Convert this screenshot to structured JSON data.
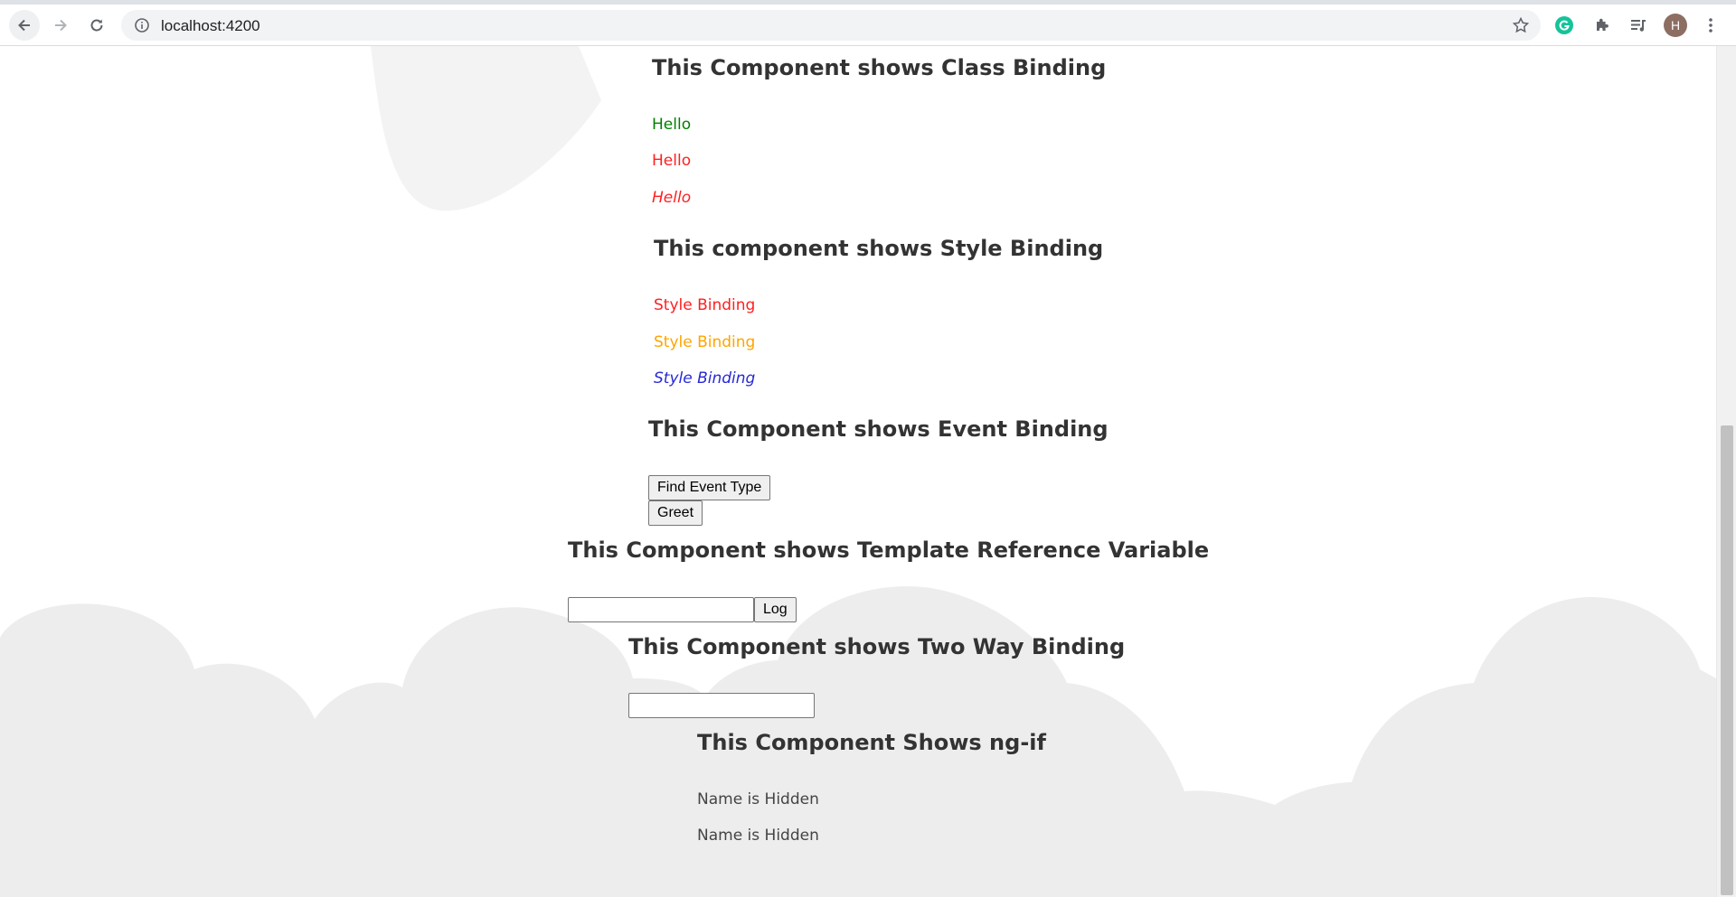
{
  "browser": {
    "url": "localhost:4200",
    "avatar_letter": "H",
    "icons": {
      "back": "arrow-left-icon",
      "forward": "arrow-right-icon",
      "reload": "reload-icon",
      "site_info": "info-icon",
      "bookmark": "star-icon",
      "grammarly": "grammarly-icon",
      "extensions": "puzzle-icon",
      "media": "media-queue-icon",
      "menu": "kebab-menu-icon"
    }
  },
  "class_binding": {
    "heading": "This Component shows Class Binding",
    "lines": [
      "Hello",
      "Hello",
      "Hello"
    ]
  },
  "style_binding": {
    "heading": "This component shows Style Binding",
    "lines": [
      "Style Binding",
      "Style Binding",
      "Style Binding"
    ]
  },
  "event_binding": {
    "heading": "This Component shows Event Binding",
    "find_event_type_label": "Find Event Type",
    "greet_label": "Greet"
  },
  "template_ref": {
    "heading": "This Component shows Template Reference Variable",
    "input_value": "",
    "log_label": "Log"
  },
  "two_way": {
    "heading": "This Component shows Two Way Binding",
    "input_value": ""
  },
  "ng_if": {
    "heading": "This Component Shows ng-if",
    "lines": [
      "Name is Hidden",
      "Name is Hidden"
    ]
  },
  "colors": {
    "green": "#008000",
    "red": "#ff2020",
    "orange": "#ffa500",
    "blue": "#2828d8",
    "cloud": "#ededed",
    "heading": "#333333"
  }
}
